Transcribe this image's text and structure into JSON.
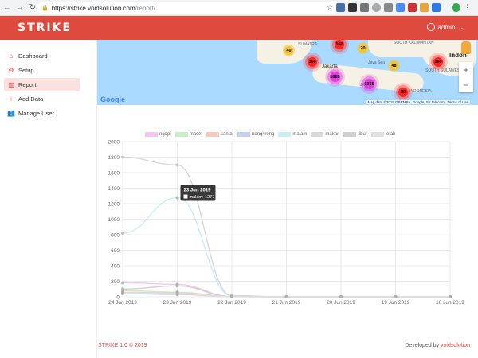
{
  "browser": {
    "url_host": "https://strike.voidsolution.com",
    "url_path": "/report/"
  },
  "header": {
    "logo": "STRIKE",
    "user": "admin"
  },
  "sidebar": {
    "items": [
      {
        "label": "Dashboard",
        "icon": "home-icon"
      },
      {
        "label": "Setup",
        "icon": "gear-icon"
      },
      {
        "label": "Report",
        "icon": "chart-icon",
        "active": true
      },
      {
        "label": "Add Data",
        "icon": "plus-icon"
      },
      {
        "label": "Manage User",
        "icon": "users-icon"
      }
    ]
  },
  "map": {
    "labels": [
      "SUMATRA",
      "Jakarta",
      "Java Sea",
      "SOUTH KALIMANTAN",
      "SOUTH SULAWESI",
      "JAVA",
      "INDONESIA",
      "Indon"
    ],
    "clusters": [
      {
        "value": "160",
        "color": "red"
      },
      {
        "value": "20",
        "color": "yellow"
      },
      {
        "value": "40",
        "color": "yellow"
      },
      {
        "value": "160",
        "color": "red"
      },
      {
        "value": "1882",
        "color": "pink"
      },
      {
        "value": "1355",
        "color": "pink"
      },
      {
        "value": "48",
        "color": "yellow"
      },
      {
        "value": "160",
        "color": "red"
      },
      {
        "value": "50",
        "color": "red"
      }
    ],
    "google": "Google",
    "credit": "Map data ©2019 GBRMPA, Google, SK telecom",
    "terms": "Terms of Use"
  },
  "chart_data": {
    "type": "line",
    "categories": [
      "24 Jun 2019",
      "23 Jun 2019",
      "22 Jun 2019",
      "21 Jun 2019",
      "20 Jun 2019",
      "19 Jun 2019",
      "18 Jun 2019"
    ],
    "ylim": [
      0,
      2000
    ],
    "yticks": [
      0,
      200,
      400,
      600,
      800,
      1000,
      1200,
      1400,
      1600,
      1800,
      2000
    ],
    "series": [
      {
        "name": "ngopi",
        "color": "#f7c6f0",
        "values": [
          180,
          160,
          5,
          0,
          0,
          0,
          0
        ]
      },
      {
        "name": "macet",
        "color": "#c8f0c8",
        "values": [
          80,
          60,
          3,
          0,
          0,
          0,
          0
        ]
      },
      {
        "name": "santai",
        "color": "#f8c8c0",
        "values": [
          60,
          50,
          2,
          0,
          0,
          0,
          0
        ]
      },
      {
        "name": "nongkrong",
        "color": "#c8d0f0",
        "values": [
          40,
          30,
          2,
          0,
          0,
          0,
          0
        ]
      },
      {
        "name": "malam",
        "color": "#c8f0f0",
        "values": [
          820,
          1277,
          10,
          0,
          0,
          0,
          0
        ]
      },
      {
        "name": "makan",
        "color": "#d8d8d8",
        "values": [
          1800,
          1700,
          15,
          0,
          0,
          0,
          0
        ]
      },
      {
        "name": "libur",
        "color": "#d0d0d0",
        "values": [
          100,
          140,
          3,
          0,
          0,
          0,
          0
        ]
      },
      {
        "name": "lelah",
        "color": "#e0e0e0",
        "values": [
          50,
          40,
          1,
          0,
          0,
          0,
          0
        ]
      }
    ],
    "tooltip": {
      "title": "23 Jun 2019",
      "label": "malam: 1277"
    }
  },
  "footer": {
    "left": "STRIKE 1.0 © 2019",
    "right_prefix": "Developed by ",
    "right_link": "voidsolution"
  },
  "colors": {
    "brand": "#de4b3e"
  }
}
